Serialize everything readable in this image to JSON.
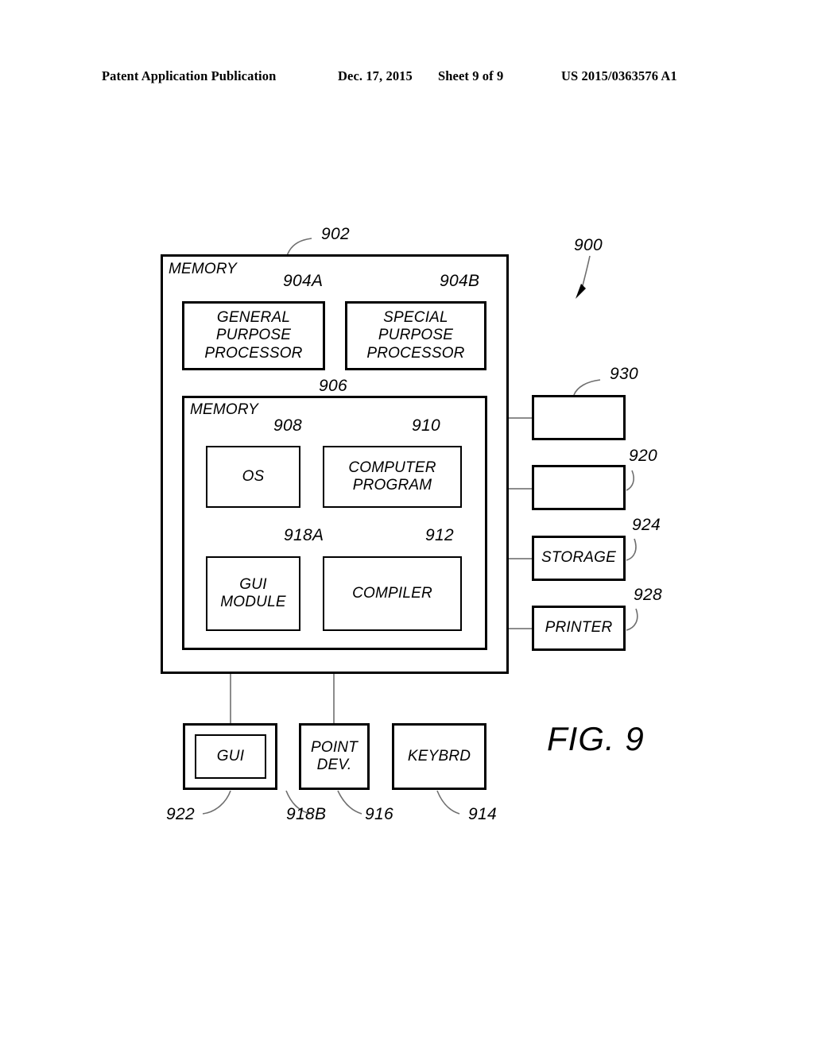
{
  "header": {
    "publication": "Patent Application Publication",
    "date": "Dec. 17, 2015",
    "sheet": "Sheet 9 of 9",
    "number": "US 2015/0363576 A1"
  },
  "figure": {
    "caption": "FIG.  9",
    "system_ref": "900"
  },
  "outer_system": {
    "ref": "902",
    "label": "MEMORY"
  },
  "processors": [
    {
      "ref": "904A",
      "label": "GENERAL\nPURPOSE\nPROCESSOR"
    },
    {
      "ref": "904B",
      "label": "SPECIAL\nPURPOSE\nPROCESSOR"
    }
  ],
  "inner_memory": {
    "ref": "906",
    "label": "MEMORY",
    "modules": [
      {
        "ref": "908",
        "label": "OS"
      },
      {
        "ref": "910",
        "label": "COMPUTER\nPROGRAM"
      },
      {
        "ref": "918A",
        "label": "GUI\nMODULE"
      },
      {
        "ref": "912",
        "label": "COMPILER"
      }
    ]
  },
  "peripherals": [
    {
      "ref": "930",
      "label": ""
    },
    {
      "ref": "920",
      "label": ""
    },
    {
      "ref": "924",
      "label": "STORAGE"
    },
    {
      "ref": "928",
      "label": "PRINTER"
    }
  ],
  "io_devices": [
    {
      "ref": "922",
      "label": ""
    },
    {
      "ref": "918B",
      "label": "GUI"
    },
    {
      "ref": "916",
      "label": "POINT\nDEV."
    },
    {
      "ref": "914",
      "label": "KEYBRD"
    }
  ],
  "colors": {
    "ink": "#000000",
    "connector": "#8c8c8c",
    "page": "#ffffff"
  }
}
